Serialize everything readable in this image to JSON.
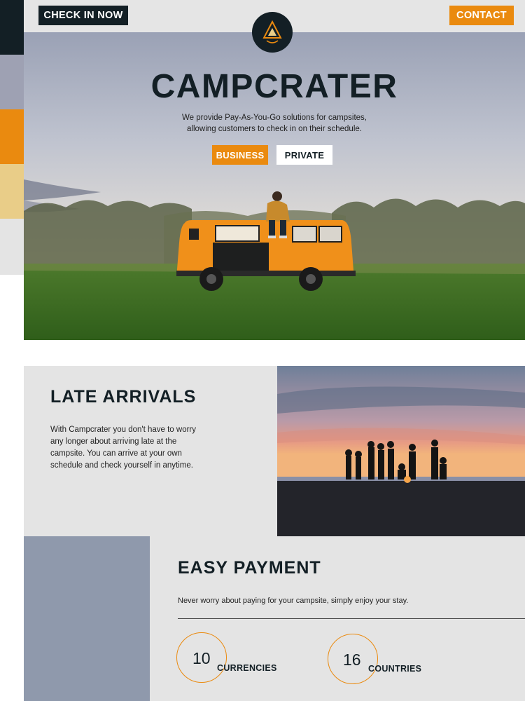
{
  "header": {
    "checkin_label": "CHECK IN NOW",
    "contact_label": "CONTACT"
  },
  "hero": {
    "title": "CAMPCRATER",
    "subtitle": "We provide Pay-As-You-Go solutions for campsites, allowing customers to check in on their schedule.",
    "business_label": "BUSINESS",
    "private_label": "PRIVATE"
  },
  "late_arrivals": {
    "title": "LATE ARRIVALS",
    "text": "With Campcrater you don't have to worry any longer about arriving late at the campsite. You can arrive at your own schedule and check yourself in anytime."
  },
  "easy_payment": {
    "title": "EASY PAYMENT",
    "text": "Never worry about paying for your campsite, simply enjoy your stay.",
    "stats": [
      {
        "value": "10",
        "label": "CURRENCIES"
      },
      {
        "value": "16",
        "label": "COUNTRIES"
      }
    ]
  },
  "colors": {
    "accent": "#ea8a0f",
    "dark": "#131f25",
    "slate": "#8f99ac",
    "sand": "#e9cd88",
    "light": "#e4e4e4"
  }
}
